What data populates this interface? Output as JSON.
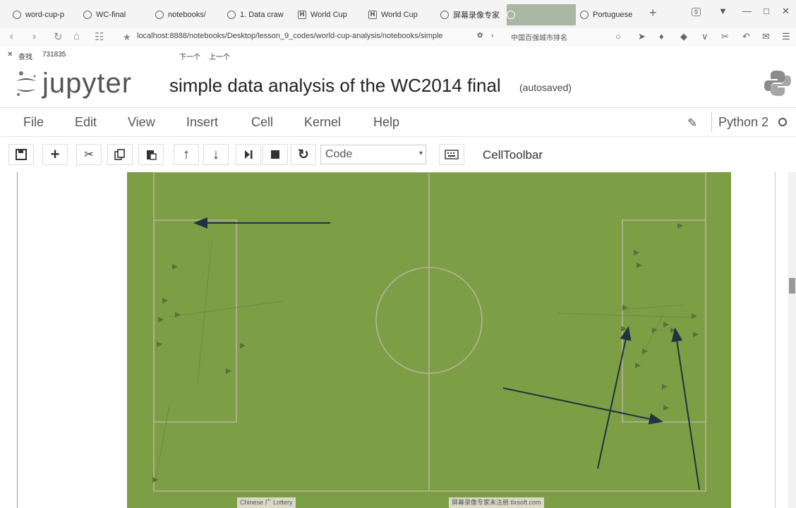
{
  "browser": {
    "tabs": [
      {
        "label": "word-cup-p"
      },
      {
        "label": "WC-final"
      },
      {
        "label": "notebooks/"
      },
      {
        "label": "1. Data craw"
      },
      {
        "label": "World Cup"
      },
      {
        "label": "World Cup"
      },
      {
        "label": "屏幕录像专家"
      },
      {
        "label": "Portuguese"
      }
    ],
    "tab_count": "9",
    "url": "localhost:8888/notebooks/Desktop/lesson_9_codes/world-cup-analysis/notebooks/simple",
    "side_text": "中国百强城市排名"
  },
  "findbar": {
    "label": "查找",
    "query": "731835",
    "next": "下一个",
    "prev": "上一个"
  },
  "jupyter": {
    "logo_text": "jupyter",
    "notebook_title": "simple data analysis of the WC2014 final",
    "autosave": "(autosaved)",
    "menu": [
      "File",
      "Edit",
      "View",
      "Insert",
      "Cell",
      "Kernel",
      "Help"
    ],
    "kernel": "Python 2",
    "cell_type": "Code",
    "celltoolbar_label": "CellToolbar"
  },
  "icons": {
    "save": "save-icon",
    "add": "plus-icon",
    "cut": "scissors-icon",
    "copy": "copy-icon",
    "paste": "paste-icon",
    "up": "arrow-up-icon",
    "down": "arrow-down-icon",
    "run": "run-icon",
    "stop": "stop-icon",
    "restart": "restart-icon",
    "keyboard": "keyboard-icon"
  },
  "colors": {
    "pitch": "#7c9e45",
    "pitch_lines": "#b9b39a",
    "arrows": "#1f3340",
    "active_tab": "#a9b7a4"
  },
  "watermarks": {
    "left": "Chinese 广 Lottery",
    "right": "屏幕录像专家未注册 tlxsoft.com"
  }
}
